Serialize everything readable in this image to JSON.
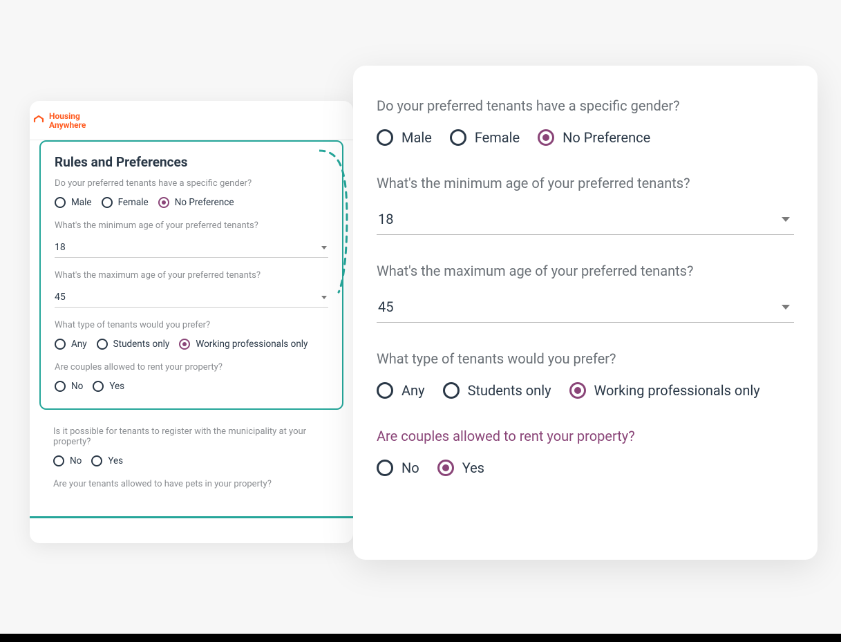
{
  "brand": {
    "line1": "Housing",
    "line2": "Anywhere",
    "color": "#ff5a1f"
  },
  "small": {
    "title": "Rules and Preferences",
    "gender": {
      "question": "Do your preferred tenants have a specific gender?",
      "options": [
        "Male",
        "Female",
        "No Preference"
      ],
      "selected": "No Preference"
    },
    "min_age": {
      "question": "What's the minimum age of your preferred tenants?",
      "value": "18"
    },
    "max_age": {
      "question": "What's the maximum age of your preferred tenants?",
      "value": "45"
    },
    "tenant_type": {
      "question": "What type of tenants would you prefer?",
      "options": [
        "Any",
        "Students only",
        "Working professionals only"
      ],
      "selected": "Working professionals only"
    },
    "couples": {
      "question": "Are couples allowed to rent your property?",
      "options": [
        "No",
        "Yes"
      ],
      "selected": null
    },
    "municipality": {
      "question": "Is it possible for tenants to register with the municipality at your property?",
      "options": [
        "No",
        "Yes"
      ],
      "selected": null
    },
    "pets": {
      "question": "Are your tenants allowed to have pets in your property?"
    }
  },
  "large": {
    "gender": {
      "question": "Do your preferred tenants have a specific gender?",
      "options": [
        "Male",
        "Female",
        "No Preference"
      ],
      "selected": "No Preference"
    },
    "min_age": {
      "question": "What's the minimum age of your preferred tenants?",
      "value": "18"
    },
    "max_age": {
      "question": "What's the maximum age of your preferred tenants?",
      "value": "45"
    },
    "tenant_type": {
      "question": "What type of tenants would you prefer?",
      "options": [
        "Any",
        "Students only",
        "Working professionals only"
      ],
      "selected": "Working professionals only"
    },
    "couples": {
      "question": "Are couples allowed to rent your property?",
      "options": [
        "No",
        "Yes"
      ],
      "selected": "Yes"
    }
  }
}
